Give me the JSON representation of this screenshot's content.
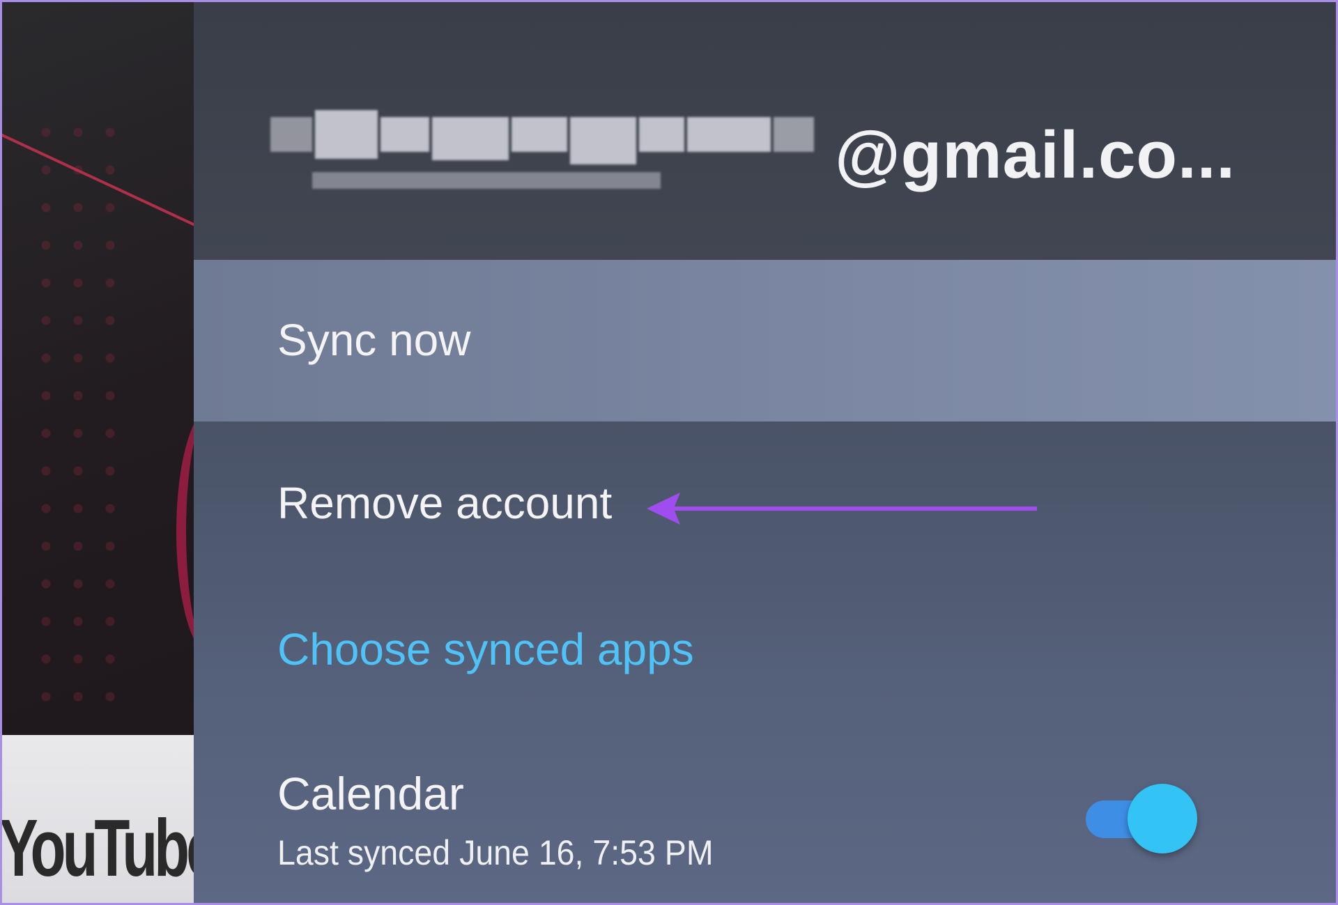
{
  "background_app": {
    "tile_label": "YouTube"
  },
  "account": {
    "email_visible_part": "@gmail.co..."
  },
  "menu": {
    "sync_now": "Sync now",
    "remove_account": "Remove account",
    "choose_synced_apps": "Choose synced apps"
  },
  "calendar": {
    "title": "Calendar",
    "last_synced": "Last synced June 16, 7:53 PM",
    "sync_enabled": true
  },
  "colors": {
    "accent_link": "#4fc3f7",
    "toggle_on": "#33c4f5",
    "annotation_arrow": "#a04df0"
  },
  "icons": {
    "annotation": "arrow-left-icon"
  }
}
